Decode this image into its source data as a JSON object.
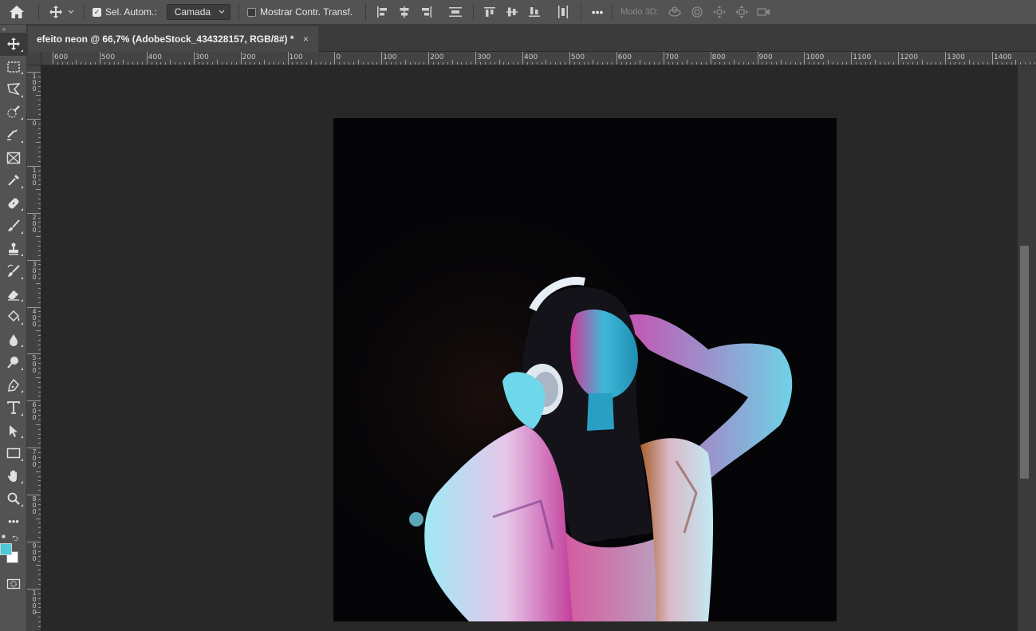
{
  "options_bar": {
    "auto_select_label": "Sel. Autom.:",
    "auto_select_checked": true,
    "auto_select_target": "Camada",
    "show_transform_label": "Mostrar Contr. Transf.",
    "show_transform_checked": false,
    "more_label": "•••",
    "mode_3d_label": "Modo 3D:"
  },
  "document_tab": {
    "title": "efeito neon @ 66,7% (AdobeStock_434328157, RGB/8#) *",
    "close_glyph": "×"
  },
  "ruler_h_labels": [
    "600",
    "500",
    "400",
    "300",
    "200",
    "100",
    "0",
    "100",
    "200",
    "300",
    "400",
    "500",
    "600",
    "700",
    "800",
    "900",
    "1000",
    "1100",
    "1200",
    "1300",
    "1400"
  ],
  "ruler_v_labels": [
    "100",
    "0",
    "100",
    "200",
    "300",
    "400",
    "500",
    "600",
    "700",
    "800",
    "900",
    "1000"
  ],
  "toolbar": {
    "tools": [
      "move-tool",
      "rectangular-marquee-tool",
      "polygonal-lasso-tool",
      "quick-selection-tool",
      "crop-tool",
      "frame-tool",
      "eyedropper-tool",
      "healing-brush-tool",
      "brush-tool",
      "clone-stamp-tool",
      "history-brush-tool",
      "eraser-tool",
      "paint-bucket-tool",
      "blur-tool",
      "dodge-tool",
      "pen-tool",
      "type-tool",
      "path-selection-tool",
      "rectangle-tool",
      "hand-tool",
      "zoom-tool",
      "edit-toolbar-tool"
    ],
    "more_label": "•••",
    "foreground_color": "#4fc8d8",
    "background_color": "#ffffff"
  },
  "colors": {
    "ui_panel": "#535353",
    "workspace": "#282828",
    "neon_cyan": "#35c9e6",
    "neon_magenta": "#e04bb8"
  }
}
